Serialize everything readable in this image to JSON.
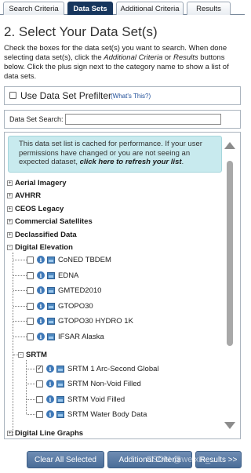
{
  "tabs": [
    {
      "label": "Search Criteria",
      "active": false
    },
    {
      "label": "Data Sets",
      "active": true
    },
    {
      "label": "Additional Criteria",
      "active": false
    },
    {
      "label": "Results",
      "active": false
    }
  ],
  "page": {
    "title": "2. Select Your Data Set(s)",
    "instructions_1": "Check the boxes for the data set(s) you want to search. When done selecting data set(s), click the ",
    "instructions_em1": "Additional Criteria",
    "instructions_2": " or ",
    "instructions_em2": "Results",
    "instructions_3": " buttons below. Click the plus sign next to the category name to show a list of data sets."
  },
  "prefilter": {
    "label": "Use Data Set Prefilter",
    "help_link": "(What's This?)",
    "checked": false
  },
  "search": {
    "label": "Data Set Search:",
    "value": "",
    "placeholder": ""
  },
  "notice": {
    "text": "This data set list is cached for performance. If your user permissions have changed or you are not seeing an expected dataset, ",
    "link": "click here to refresh your list",
    "end": "."
  },
  "categories": [
    {
      "label": "Aerial Imagery",
      "expander": "+"
    },
    {
      "label": "AVHRR",
      "expander": "+"
    },
    {
      "label": "CEOS Legacy",
      "expander": "+"
    },
    {
      "label": "Commercial Satellites",
      "expander": "+"
    },
    {
      "label": "Declassified Data",
      "expander": "+"
    },
    {
      "label": "Digital Elevation",
      "expander": "-"
    },
    {
      "label": "Digital Line Graphs",
      "expander": "+"
    }
  ],
  "digital_elevation_datasets": [
    {
      "label": "CoNED TBDEM",
      "checked": false
    },
    {
      "label": "EDNA",
      "checked": false
    },
    {
      "label": "GMTED2010",
      "checked": false
    },
    {
      "label": "GTOPO30",
      "checked": false
    },
    {
      "label": "GTOPO30 HYDRO 1K",
      "checked": false
    },
    {
      "label": "IFSAR Alaska",
      "checked": false
    }
  ],
  "srtm": {
    "label": "SRTM",
    "expander": "-",
    "datasets": [
      {
        "label": "SRTM 1 Arc-Second Global",
        "checked": true
      },
      {
        "label": "SRTM Non-Void Filled",
        "checked": false
      },
      {
        "label": "SRTM Void Filled",
        "checked": false
      },
      {
        "label": "SRTM Water Body Data",
        "checked": false
      }
    ]
  },
  "buttons": {
    "clear_all": "Clear All Selected",
    "additional_criteria": "Additional Criteria",
    "results": "Results >>"
  },
  "watermark": "CSDN @weixin_...",
  "colors": {
    "active_tab": "#17365d",
    "notice_bg": "#c8eaee",
    "button": "#4a6d98",
    "link": "#1f4e99"
  },
  "icons": {
    "info": "info-icon",
    "thumbnail": "thumbnail-icon",
    "expand": "plus-box-icon",
    "collapse": "minus-box-icon"
  }
}
